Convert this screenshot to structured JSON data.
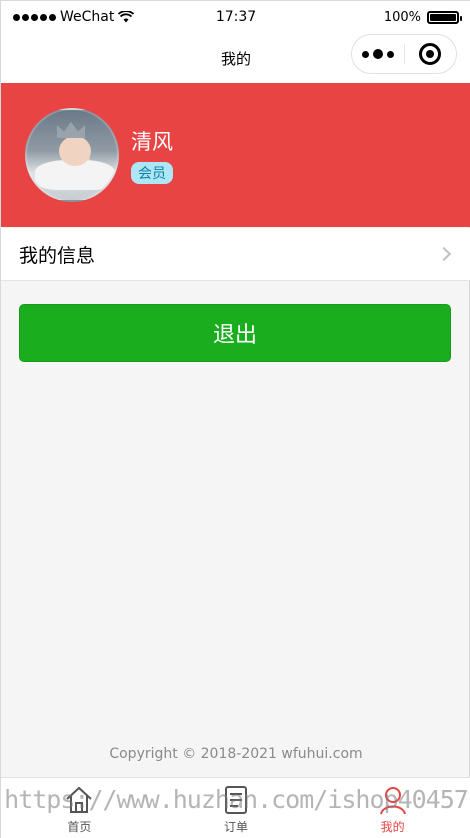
{
  "status_bar": {
    "carrier": "WeChat",
    "time": "17:37",
    "battery": "100%",
    "battery_level": 1.0
  },
  "nav_bar": {
    "title": "我的"
  },
  "profile": {
    "name": "清风",
    "badge": "会员"
  },
  "menu": {
    "my_info": "我的信息"
  },
  "logout": {
    "label": "退出"
  },
  "footer": {
    "copyright": "Copyright © 2018-2021 wfuhui.com"
  },
  "tabs": [
    {
      "label": "首页",
      "icon": "home-icon",
      "active": false
    },
    {
      "label": "订单",
      "icon": "order-icon",
      "active": false
    },
    {
      "label": "我的",
      "icon": "user-icon",
      "active": true
    }
  ],
  "watermark": "https://www.huzhan.com/ishop40457",
  "colors": {
    "header_red": "#e84444",
    "button_green": "#1aad1e",
    "badge_bg": "#aee6f6",
    "badge_text": "#0f80a8"
  }
}
